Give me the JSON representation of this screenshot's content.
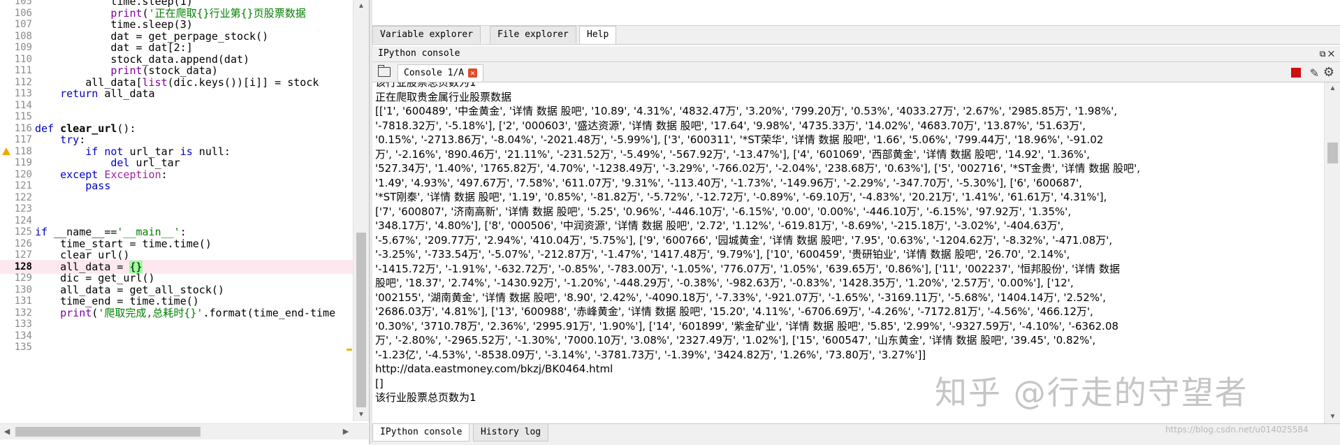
{
  "editor": {
    "lines": [
      {
        "num": "105",
        "parts": [
          {
            "t": "            time.sleep(1)"
          }
        ]
      },
      {
        "num": "106",
        "parts": [
          {
            "t": "            "
          },
          {
            "t": "print",
            "c": "fn"
          },
          {
            "t": "(",
            "c": ""
          },
          {
            "t": "'正在爬取{}行业第{}页股票数据",
            "c": "str"
          }
        ]
      },
      {
        "num": "107",
        "parts": [
          {
            "t": "            time.sleep(3)"
          }
        ]
      },
      {
        "num": "108",
        "parts": [
          {
            "t": "            dat = get_perpage_stock()"
          }
        ]
      },
      {
        "num": "109",
        "parts": [
          {
            "t": "            dat = dat[2:]"
          }
        ]
      },
      {
        "num": "110",
        "parts": [
          {
            "t": "            stock_data.append(dat)"
          }
        ]
      },
      {
        "num": "111",
        "parts": [
          {
            "t": "            "
          },
          {
            "t": "print",
            "c": "fn"
          },
          {
            "t": "(stock_data)"
          }
        ]
      },
      {
        "num": "112",
        "parts": [
          {
            "t": "        all_data["
          },
          {
            "t": "list",
            "c": "fn"
          },
          {
            "t": "(dic.keys())[i]] = stock"
          }
        ]
      },
      {
        "num": "113",
        "parts": [
          {
            "t": "    "
          },
          {
            "t": "return",
            "c": "kw"
          },
          {
            "t": " all_data"
          }
        ]
      },
      {
        "num": "114",
        "parts": [
          {
            "t": ""
          }
        ]
      },
      {
        "num": "115",
        "parts": [
          {
            "t": ""
          }
        ]
      },
      {
        "num": "116",
        "parts": [
          {
            "t": "def",
            "c": "kw"
          },
          {
            "t": " "
          },
          {
            "t": "clear_url",
            "c": "bold"
          },
          {
            "t": "():"
          }
        ]
      },
      {
        "num": "117",
        "parts": [
          {
            "t": "    "
          },
          {
            "t": "try",
            "c": "kw"
          },
          {
            "t": ":"
          }
        ]
      },
      {
        "num": "118",
        "warn": true,
        "parts": [
          {
            "t": "        "
          },
          {
            "t": "if not",
            "c": "kw"
          },
          {
            "t": " url_tar "
          },
          {
            "t": "is",
            "c": "kw"
          },
          {
            "t": " null:"
          }
        ]
      },
      {
        "num": "119",
        "parts": [
          {
            "t": "            "
          },
          {
            "t": "del",
            "c": "kw"
          },
          {
            "t": " url_tar"
          }
        ]
      },
      {
        "num": "120",
        "parts": [
          {
            "t": "    "
          },
          {
            "t": "except",
            "c": "kw"
          },
          {
            "t": " "
          },
          {
            "t": "Exception",
            "c": "kw2"
          },
          {
            "t": ":"
          }
        ]
      },
      {
        "num": "121",
        "parts": [
          {
            "t": "        "
          },
          {
            "t": "pass",
            "c": "kw"
          }
        ]
      },
      {
        "num": "122",
        "parts": [
          {
            "t": ""
          }
        ]
      },
      {
        "num": "123",
        "parts": [
          {
            "t": ""
          }
        ]
      },
      {
        "num": "124",
        "parts": [
          {
            "t": ""
          }
        ]
      },
      {
        "num": "125",
        "parts": [
          {
            "t": "if",
            "c": "kw"
          },
          {
            "t": " __name__=="
          },
          {
            "t": "'__main__'",
            "c": "str"
          },
          {
            "t": ":"
          }
        ]
      },
      {
        "num": "126",
        "parts": [
          {
            "t": "    time_start = time.time()"
          }
        ]
      },
      {
        "num": "127",
        "parts": [
          {
            "t": "    clear_url()"
          }
        ]
      },
      {
        "num": "128",
        "current": true,
        "parts": [
          {
            "t": "    all_data = "
          },
          {
            "t": "{}",
            "c": "brace"
          }
        ]
      },
      {
        "num": "129",
        "parts": [
          {
            "t": "    dic = get_url()"
          }
        ]
      },
      {
        "num": "130",
        "parts": [
          {
            "t": "    all_data = get_all_stock()"
          }
        ]
      },
      {
        "num": "131",
        "parts": [
          {
            "t": "    time_end = time.time()"
          }
        ]
      },
      {
        "num": "132",
        "parts": [
          {
            "t": "    "
          },
          {
            "t": "print",
            "c": "fn"
          },
          {
            "t": "("
          },
          {
            "t": "'爬取完成,总耗时{}'",
            "c": "str"
          },
          {
            "t": ".format(time_end-time"
          }
        ]
      },
      {
        "num": "133",
        "parts": [
          {
            "t": ""
          }
        ]
      },
      {
        "num": "134",
        "parts": [
          {
            "t": ""
          }
        ]
      },
      {
        "num": "135",
        "parts": [
          {
            "t": ""
          }
        ]
      }
    ]
  },
  "top_tabs": [
    "Variable explorer",
    "File explorer",
    "Help"
  ],
  "console_pane_title": "IPython console",
  "console_tab_label": "Console 1/A",
  "console_lines": [
    "该行业股票总页数为1",
    "正在爬取贵金属行业股票数据",
    "[['1', '600489', '中金黄金', '详情 数据 股吧', '10.89', '4.31%', '4832.47万', '3.20%', '799.20万', '0.53%', '4033.27万', '2.67%', '2985.85万', '1.98%',",
    "'-7818.32万', '-5.18%'], ['2', '000603', '盛达资源', '详情 数据 股吧', '17.64', '9.98%', '4735.33万', '14.02%', '4683.70万', '13.87%', '51.63万',",
    "'0.15%', '-2713.86万', '-8.04%', '-2021.48万', '-5.99%'], ['3', '600311', '*ST荣华', '详情 数据 股吧', '1.66', '5.06%', '799.44万', '18.96%', '-91.02",
    "万', '-2.16%', '890.46万', '21.11%', '-231.52万', '-5.49%', '-567.92万', '-13.47%'], ['4', '601069', '西部黄金', '详情 数据 股吧', '14.92', '1.36%',",
    "'527.34万', '1.40%', '1765.82万', '4.70%', '-1238.49万', '-3.29%', '-766.02万', '-2.04%', '238.68万', '0.63%'], ['5', '002716', '*ST金贵', '详情 数据 股吧',",
    "'1.49', '4.93%', '497.67万', '7.58%', '611.07万', '9.31%', '-113.40万', '-1.73%', '-149.96万', '-2.29%', '-347.70万', '-5.30%'], ['6', '600687',",
    "'*ST刚泰', '详情 数据 股吧', '1.19', '0.85%', '-81.82万', '-5.72%', '-12.72万', '-0.89%', '-69.10万', '-4.83%', '20.21万', '1.41%', '61.61万', '4.31%'],",
    "['7', '600807', '济南高新', '详情 数据 股吧', '5.25', '0.96%', '-446.10万', '-6.15%', '0.00', '0.00%', '-446.10万', '-6.15%', '97.92万', '1.35%',",
    "'348.17万', '4.80%'], ['8', '000506', '中润资源', '详情 数据 股吧', '2.72', '1.12%', '-619.81万', '-8.69%', '-215.18万', '-3.02%', '-404.63万',",
    "'-5.67%', '209.77万', '2.94%', '410.04万', '5.75%'], ['9', '600766', '园城黄金', '详情 数据 股吧', '7.95', '0.63%', '-1204.62万', '-8.32%', '-471.08万',",
    "'-3.25%', '-733.54万', '-5.07%', '-212.87万', '-1.47%', '1417.48万', '9.79%'], ['10', '600459', '贵研铂业', '详情 数据 股吧', '26.70', '2.14%',",
    "'-1415.72万', '-1.91%', '-632.72万', '-0.85%', '-783.00万', '-1.05%', '776.07万', '1.05%', '639.65万', '0.86%'], ['11', '002237', '恒邦股份', '详情 数据",
    "股吧', '18.37', '2.74%', '-1430.92万', '-1.20%', '-448.29万', '-0.38%', '-982.63万', '-0.83%', '1428.35万', '1.20%', '2.57万', '0.00%'], ['12',",
    "'002155', '湖南黄金', '详情 数据 股吧', '8.90', '2.42%', '-4090.18万', '-7.33%', '-921.07万', '-1.65%', '-3169.11万', '-5.68%', '1404.14万', '2.52%',",
    "'2686.03万', '4.81%'], ['13', '600988', '赤峰黄金', '详情 数据 股吧', '15.20', '4.11%', '-6706.69万', '-4.26%', '-7172.81万', '-4.56%', '466.12万',",
    "'0.30%', '3710.78万', '2.36%', '2995.91万', '1.90%'], ['14', '601899', '紫金矿业', '详情 数据 股吧', '5.85', '2.99%', '-9327.59万', '-4.10%', '-6362.08",
    "万', '-2.80%', '-2965.52万', '-1.30%', '7000.10万', '3.08%', '2327.49万', '1.02%'], ['15', '600547', '山东黄金', '详情 数据 股吧', '39.45', '0.82%',",
    "'-1.23亿', '-4.53%', '-8538.09万', '-3.14%', '-3781.73万', '-1.39%', '3424.82万', '1.26%', '73.80万', '3.27%']]",
    "http://data.eastmoney.com/bkzj/BK0464.html",
    "[]",
    "该行业股票总页数为1"
  ],
  "bottom_tabs": [
    "IPython console",
    "History log"
  ],
  "watermark": "知乎 @行走的守望者",
  "watermark_url": "https://blog.csdn.net/u014025584"
}
